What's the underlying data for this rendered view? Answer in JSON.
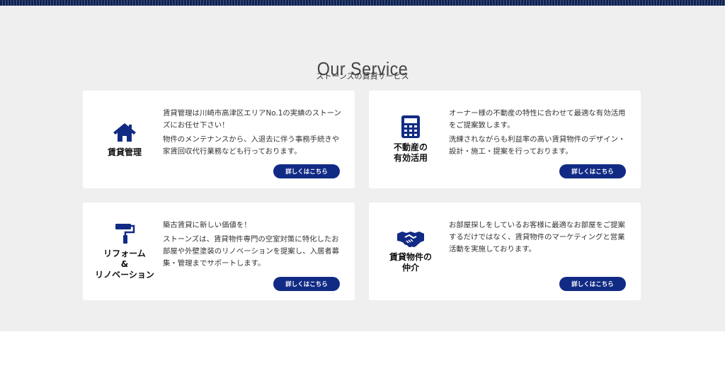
{
  "section": {
    "title": "Our Service",
    "subtitle": "ストーンズの賃貸サービス"
  },
  "colors": {
    "accent": "#112b85",
    "section_bg": "#efefef",
    "card_bg": "#ffffff"
  },
  "cards": [
    {
      "icon": "house-icon",
      "name": "賃貸管理",
      "paragraphs": [
        "賃貸管理は川崎市高津区エリアNo.1の実績のストーンズにお任せ下さい！",
        "物件のメンテナンスから、入退去に伴う事務手続きや家賃回収代行業務なども行っております。"
      ],
      "button": "詳しくはこちら"
    },
    {
      "icon": "calculator-icon",
      "name": "不動産の\n有効活用",
      "paragraphs": [
        "オーナー様の不動産の特性に合わせて最適な有効活用をご提案致します。",
        "洗練されながらも利益率の高い賃貸物件のデザイン・設計・施工・提案を行っております。"
      ],
      "button": "詳しくはこちら"
    },
    {
      "icon": "paint-roller-icon",
      "name": "リフォーム\n&\nリノベーション",
      "paragraphs": [
        "築古賃貸に新しい価値を！",
        "ストーンズは、賃貸物件専門の空室対策に特化したお部屋や外壁塗装のリノベーションを提案し、入居者募集・管理までサポートします。"
      ],
      "button": "詳しくはこちら"
    },
    {
      "icon": "handshake-icon",
      "name": "賃貸物件の\n仲介",
      "paragraphs": [
        "お部屋探しをしているお客様に最適なお部屋をご提案するだけではなく、賃貸物件のマーケティングと営業活動を実施しております。"
      ],
      "button": "詳しくはこちら"
    }
  ]
}
